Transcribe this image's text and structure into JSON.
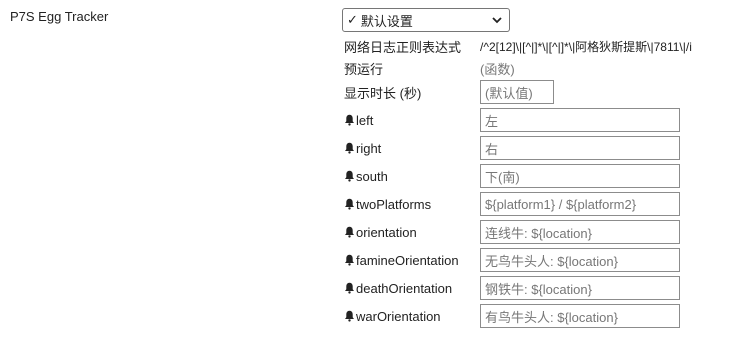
{
  "trigger": {
    "name": "P7S Egg Tracker",
    "select": {
      "check": "✓",
      "value": "默认设置"
    }
  },
  "options": {
    "regex_label": "网络日志正则表达式",
    "regex_value": "/^2[12]\\|[^|]*\\|[^|]*\\|阿格狄斯提斯\\|7811\\|/i",
    "prerun_label": "预运行",
    "prerun_value": "(函数)",
    "duration_label": "显示时长 (秒)",
    "duration_placeholder": "(默认值)"
  },
  "outputs": [
    {
      "key": "left",
      "placeholder": "左"
    },
    {
      "key": "right",
      "placeholder": "右"
    },
    {
      "key": "south",
      "placeholder": "下(南)"
    },
    {
      "key": "twoPlatforms",
      "placeholder": "${platform1} / ${platform2}"
    },
    {
      "key": "orientation",
      "placeholder": "连线牛: ${location}"
    },
    {
      "key": "famineOrientation",
      "placeholder": "无鸟牛头人: ${location}"
    },
    {
      "key": "deathOrientation",
      "placeholder": "钢铁牛: ${location}"
    },
    {
      "key": "warOrientation",
      "placeholder": "有鸟牛头人: ${location}"
    }
  ]
}
